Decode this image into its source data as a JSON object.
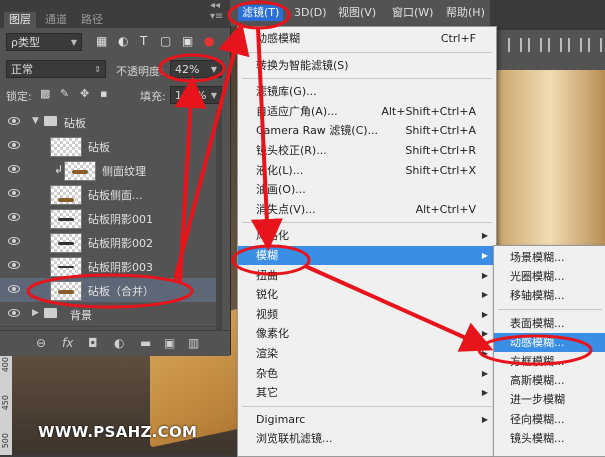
{
  "watermark": "WWW.PSAHZ.COM",
  "ruler_labels": [
    "400",
    "450",
    "500"
  ],
  "layers_panel": {
    "tabs": [
      "图层",
      "通道",
      "路径"
    ],
    "close_glyph": "◂◂ ▾≡",
    "filter_kind": "ρ类型",
    "blend_mode": "正常",
    "opacity_label": "不透明度:",
    "opacity_value": "42%",
    "lock_label": "锁定:",
    "fill_label": "填充:",
    "fill_value": "100%",
    "layers": [
      {
        "name": "砧板",
        "kind": "group"
      },
      {
        "name": "砧板",
        "kind": "layer"
      },
      {
        "name": "侧面纹理",
        "kind": "clipped"
      },
      {
        "name": "砧板侧面...",
        "kind": "layer"
      },
      {
        "name": "砧板阴影001",
        "kind": "layer"
      },
      {
        "name": "砧板阴影002",
        "kind": "layer"
      },
      {
        "name": "砧板阴影003",
        "kind": "layer"
      },
      {
        "name": "砧板（合并）",
        "kind": "layer",
        "selected": true
      },
      {
        "name": "背景",
        "kind": "group-closed"
      }
    ],
    "bottom_icons": [
      "link-icon",
      "fx-icon",
      "mask-icon",
      "adjustment-icon",
      "folder-icon",
      "new-layer-icon",
      "trash-icon"
    ],
    "bottom_glyphs": [
      "⊖",
      "fx",
      "◘",
      "◐",
      "▬",
      "▣",
      "▥"
    ]
  },
  "menubar": {
    "items": [
      "滤镜(T)",
      "3D(D)",
      "视图(V)",
      "窗口(W)",
      "帮助(H)"
    ]
  },
  "filter_menu": {
    "items": [
      {
        "label": "动感模糊",
        "shortcut": "Ctrl+F"
      },
      {
        "sep": true
      },
      {
        "label": "转换为智能滤镜(S)",
        "shortcut": ""
      },
      {
        "sep": true
      },
      {
        "label": "滤镜库(G)...",
        "shortcut": ""
      },
      {
        "label": "自适应广角(A)...",
        "shortcut": "Alt+Shift+Ctrl+A"
      },
      {
        "label": "Camera Raw 滤镜(C)...",
        "shortcut": "Shift+Ctrl+A"
      },
      {
        "label": "镜头校正(R)...",
        "shortcut": "Shift+Ctrl+R"
      },
      {
        "label": "液化(L)...",
        "shortcut": "Shift+Ctrl+X"
      },
      {
        "label": "油画(O)...",
        "shortcut": ""
      },
      {
        "label": "消失点(V)...",
        "shortcut": "Alt+Ctrl+V"
      },
      {
        "sep": true
      },
      {
        "label": "风格化",
        "submenu": true
      },
      {
        "label": "模糊",
        "submenu": true,
        "highlight": true
      },
      {
        "label": "扭曲",
        "submenu": true
      },
      {
        "label": "锐化",
        "submenu": true
      },
      {
        "label": "视频",
        "submenu": true
      },
      {
        "label": "像素化",
        "submenu": true
      },
      {
        "label": "渲染",
        "submenu": true
      },
      {
        "label": "杂色",
        "submenu": true
      },
      {
        "label": "其它",
        "submenu": true
      },
      {
        "sep": true
      },
      {
        "label": "Digimarc",
        "submenu": true
      },
      {
        "label": "浏览联机滤镜...",
        "shortcut": ""
      }
    ]
  },
  "blur_submenu": {
    "items": [
      {
        "label": "场景模糊..."
      },
      {
        "label": "光圈模糊..."
      },
      {
        "label": "移轴模糊..."
      },
      {
        "sep": true
      },
      {
        "label": "表面模糊..."
      },
      {
        "label": "动感模糊...",
        "highlight": true
      },
      {
        "label": "方框模糊..."
      },
      {
        "label": "高斯模糊..."
      },
      {
        "label": "进一步模糊"
      },
      {
        "label": "径向模糊..."
      },
      {
        "label": "镜头模糊..."
      }
    ]
  },
  "colors": {
    "menu_highlight": "#3a8ee6",
    "annotation": "#e8141c",
    "panel": "#535353"
  }
}
